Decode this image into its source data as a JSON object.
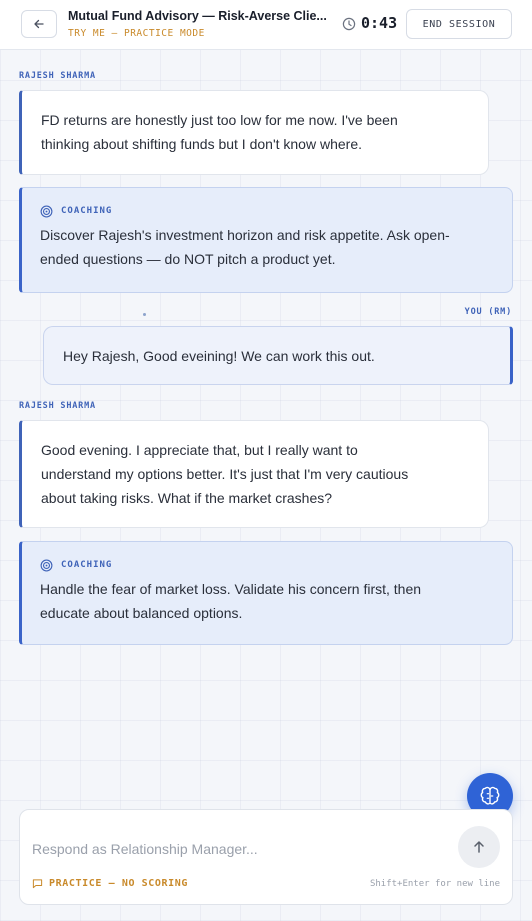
{
  "header": {
    "back_icon": "arrow-left-icon",
    "title": "Mutual Fund Advisory — Risk-Averse Clie...",
    "subtitle": "TRY ME — PRACTICE MODE",
    "timer_icon": "clock-icon",
    "timer": "0:43",
    "end_session_label": "END SESSION"
  },
  "messages": [
    {
      "role": "client",
      "speaker": "RAJESH SHARMA",
      "lines": [
        "FD returns are honestly just too low for me now. I've been",
        "thinking about shifting funds but I don't know where."
      ]
    },
    {
      "role": "coaching",
      "label": "COACHING",
      "lines": [
        "Discover Rajesh's investment horizon and risk appetite. Ask open-",
        "ended questions — do NOT pitch a product yet."
      ]
    },
    {
      "role": "rm",
      "speaker": "YOU (RM)",
      "lines": [
        "Hey Rajesh, Good eveining! We can work this out."
      ]
    },
    {
      "role": "client",
      "speaker": "RAJESH SHARMA",
      "lines": [
        "Good evening. I appreciate that, but I really want to",
        "understand my options better. It's just that I'm very cautious",
        "about taking risks. What if the market crashes?"
      ]
    },
    {
      "role": "coaching",
      "label": "COACHING",
      "lines": [
        "Handle the fear of market loss. Validate his concern first, then",
        "educate about balanced options."
      ]
    }
  ],
  "fab": {
    "icon": "brain-icon"
  },
  "composer": {
    "placeholder": "Respond as Relationship Manager...",
    "value": "",
    "send_icon": "arrow-up-icon",
    "practice_icon": "message-square-icon",
    "practice_label": "PRACTICE — NO SCORING",
    "hint": "Shift+Enter for new line"
  },
  "colors": {
    "accent": "#2f63d6",
    "speaker": "#3f63b8",
    "practice": "#c98a2b",
    "coaching_bg": "#e6edfa",
    "rm_bg": "#eef2fb"
  }
}
